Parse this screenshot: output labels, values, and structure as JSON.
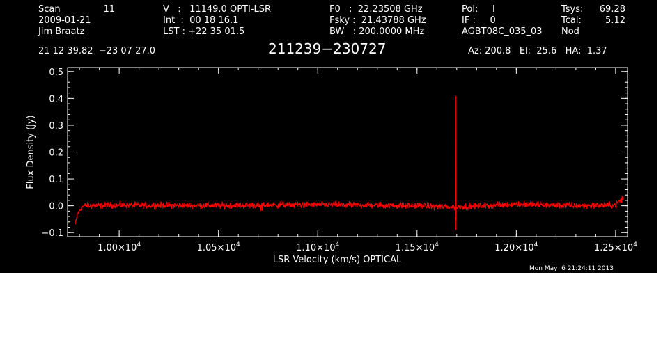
{
  "header": {
    "scan_label": "Scan",
    "scan_value": "11",
    "date": "2009-01-21",
    "observer": "Jim Braatz",
    "velocity": "V   :   11149.0 OPTI-LSR",
    "int_time": "Int  :  00 18 16.1",
    "lst": "LST : +22 35 01.5",
    "f0": "F0   :  22.23508 GHz",
    "fsky": "Fsky :  21.43788 GHz",
    "bw": "BW   : 200.0000 MHz",
    "pol": "Pol:     I",
    "if": "IF :     0",
    "project": "AGBT08C_035_03",
    "tsys_label": "Tsys:",
    "tsys_value": "69.28",
    "tcal_label": "Tcal:",
    "tcal_value": "5.12",
    "mode": "Nod",
    "coords": "21 12 39.82  −23 07 27.0",
    "source": "211239−230727",
    "azelha": "Az: 200.8   El:  25.6   HA:  1.37",
    "timestamp": "Mon May  6 21:24:11 2013"
  },
  "chart_data": {
    "type": "line",
    "xlabel": "LSR Velocity (km/s) OPTICAL",
    "ylabel": "Flux Density (Jy)",
    "xlim": [
      9740,
      12560
    ],
    "ylim": [
      -0.115,
      0.515
    ],
    "x_ticks": [
      {
        "value": 10000,
        "mantissa": "1.00",
        "exp": "4"
      },
      {
        "value": 10500,
        "mantissa": "1.05",
        "exp": "4"
      },
      {
        "value": 11000,
        "mantissa": "1.10",
        "exp": "4"
      },
      {
        "value": 11500,
        "mantissa": "1.15",
        "exp": "4"
      },
      {
        "value": 12000,
        "mantissa": "1.20",
        "exp": "4"
      },
      {
        "value": 12500,
        "mantissa": "1.25",
        "exp": "4"
      }
    ],
    "y_ticks": [
      {
        "value": -0.1,
        "label": "−0.1"
      },
      {
        "value": 0.0,
        "label": "0.0"
      },
      {
        "value": 0.1,
        "label": "0.1"
      },
      {
        "value": 0.2,
        "label": "0.2"
      },
      {
        "value": 0.3,
        "label": "0.3"
      },
      {
        "value": 0.4,
        "label": "0.4"
      },
      {
        "value": 0.5,
        "label": "0.5"
      }
    ],
    "series": [
      {
        "color": "#ff0000",
        "x_range": [
          9780,
          12540
        ],
        "noise_rms": 0.006,
        "baseline": [
          [
            9780,
            -0.07
          ],
          [
            9790,
            -0.03
          ],
          [
            9820,
            0.0
          ],
          [
            10000,
            0.002
          ],
          [
            10500,
            0.001
          ],
          [
            11000,
            0.004
          ],
          [
            11500,
            0.0
          ],
          [
            11700,
            -0.005
          ],
          [
            12000,
            0.006
          ],
          [
            12300,
            0.0
          ],
          [
            12500,
            0.003
          ],
          [
            12540,
            0.03
          ]
        ],
        "features": [
          {
            "x": 11696,
            "peak": 0.41,
            "min": -0.09
          }
        ]
      }
    ],
    "grid": false
  }
}
